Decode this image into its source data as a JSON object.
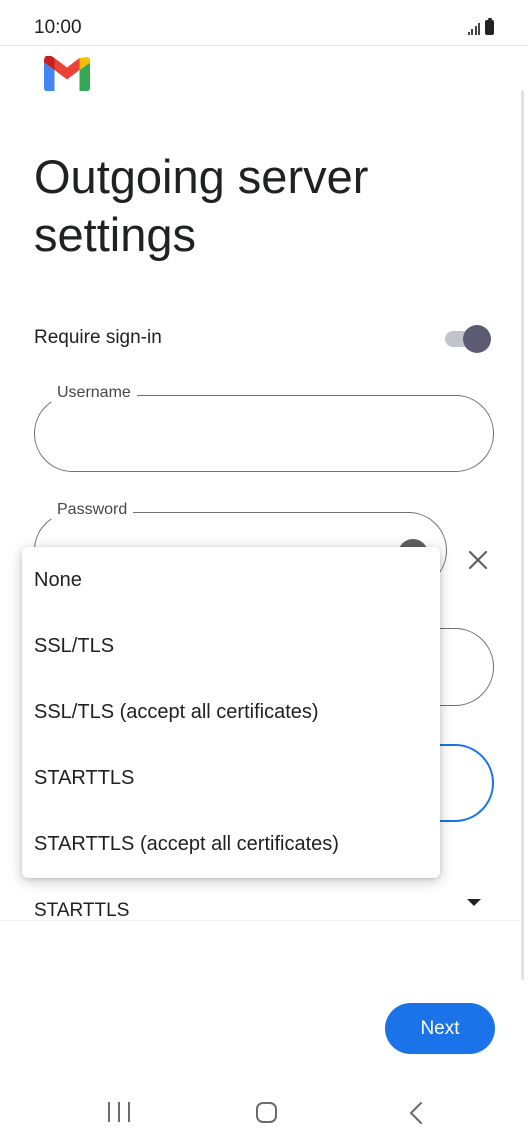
{
  "status_bar": {
    "time": "10:00"
  },
  "brand": {
    "logo_icon": "gmail-m-icon"
  },
  "page": {
    "title": "Outgoing server\nsettings"
  },
  "require_signin": {
    "label": "Require sign-in",
    "enabled": true
  },
  "username": {
    "label": "Username",
    "value": ""
  },
  "password": {
    "label": "Password",
    "value": ""
  },
  "security_type": {
    "selected": "STARTTLS"
  },
  "dropdown": {
    "options": [
      "None",
      "SSL/TLS",
      "SSL/TLS (accept all certificates)",
      "STARTTLS",
      "STARTTLS (accept all certificates)"
    ]
  },
  "actions": {
    "next_label": "Next"
  },
  "colors": {
    "accent": "#1a73e8",
    "toggle_thumb": "#5b5b73",
    "toggle_track": "#c3c3cc"
  }
}
